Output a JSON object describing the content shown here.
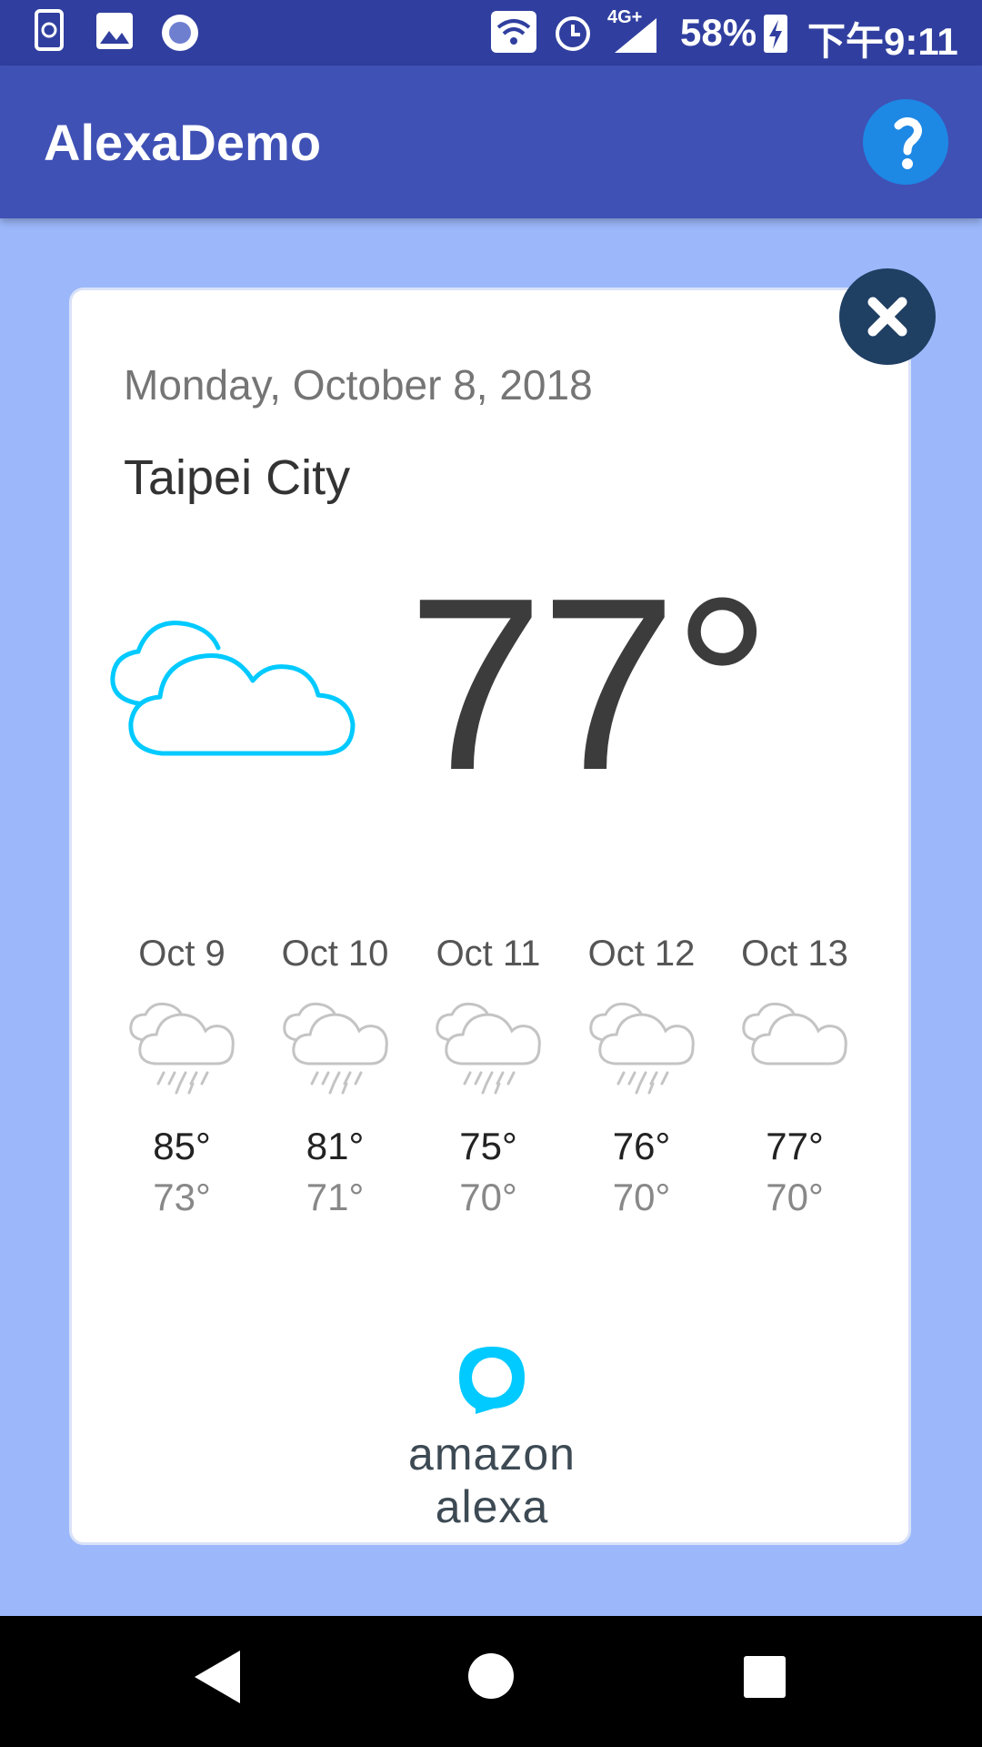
{
  "status_bar": {
    "battery": "58%",
    "time": "下午9:11",
    "network": "4G+"
  },
  "app_bar": {
    "title": "AlexaDemo"
  },
  "card": {
    "date": "Monday, October 8, 2018",
    "city": "Taipei City",
    "current_temp": "77°",
    "current_icon": "cloudy-icon",
    "forecast": [
      {
        "date": "Oct 9",
        "icon": "rain-cloud-icon",
        "high": "85°",
        "low": "73°"
      },
      {
        "date": "Oct 10",
        "icon": "rain-cloud-icon",
        "high": "81°",
        "low": "71°"
      },
      {
        "date": "Oct 11",
        "icon": "rain-cloud-icon",
        "high": "75°",
        "low": "70°"
      },
      {
        "date": "Oct 12",
        "icon": "rain-cloud-icon",
        "high": "76°",
        "low": "70°"
      },
      {
        "date": "Oct 13",
        "icon": "cloud-icon",
        "high": "77°",
        "low": "70°"
      }
    ],
    "brand": "amazon alexa"
  },
  "colors": {
    "status_bar": "#303f9f",
    "app_bar": "#3f51b5",
    "background": "#9cb8fb",
    "accent_cyan": "#00caff",
    "close_button": "#1f3f63"
  }
}
